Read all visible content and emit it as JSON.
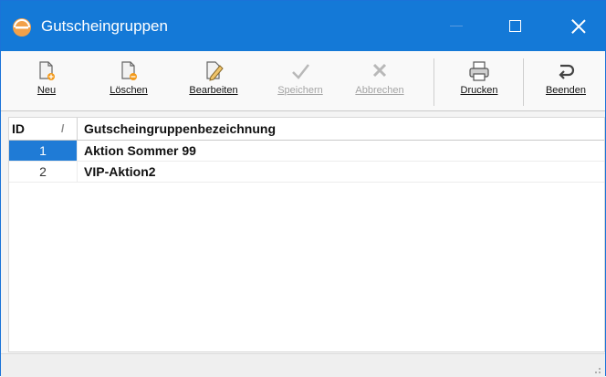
{
  "window": {
    "title": "Gutscheingruppen",
    "app_icon": "coupon-app-icon",
    "controls": [
      "minimize",
      "maximize",
      "close"
    ],
    "accent_color": "#1479d7"
  },
  "toolbar": {
    "buttons": [
      {
        "label": "Neu",
        "icon": "new-document-icon",
        "enabled": true
      },
      {
        "label": "Löschen",
        "icon": "delete-document-icon",
        "enabled": true
      },
      {
        "label": "Bearbeiten",
        "icon": "edit-pencil-icon",
        "enabled": true
      },
      {
        "label": "Speichern",
        "icon": "checkmark-icon",
        "enabled": false
      },
      {
        "label": "Abbrechen",
        "icon": "cancel-x-icon",
        "enabled": false
      },
      {
        "label": "Drucken",
        "icon": "printer-icon",
        "enabled": true
      },
      {
        "label": "Beenden",
        "icon": "exit-icon",
        "enabled": true
      }
    ]
  },
  "grid": {
    "columns": [
      {
        "label": "ID",
        "sort": "/"
      },
      {
        "label": "Gutscheingruppenbezeichnung"
      }
    ],
    "rows": [
      {
        "id": "1",
        "name": "Aktion Sommer 99",
        "selected": true
      },
      {
        "id": "2",
        "name": "VIP-Aktion2",
        "selected": false
      }
    ],
    "selection_color": "#1f7bd6"
  }
}
